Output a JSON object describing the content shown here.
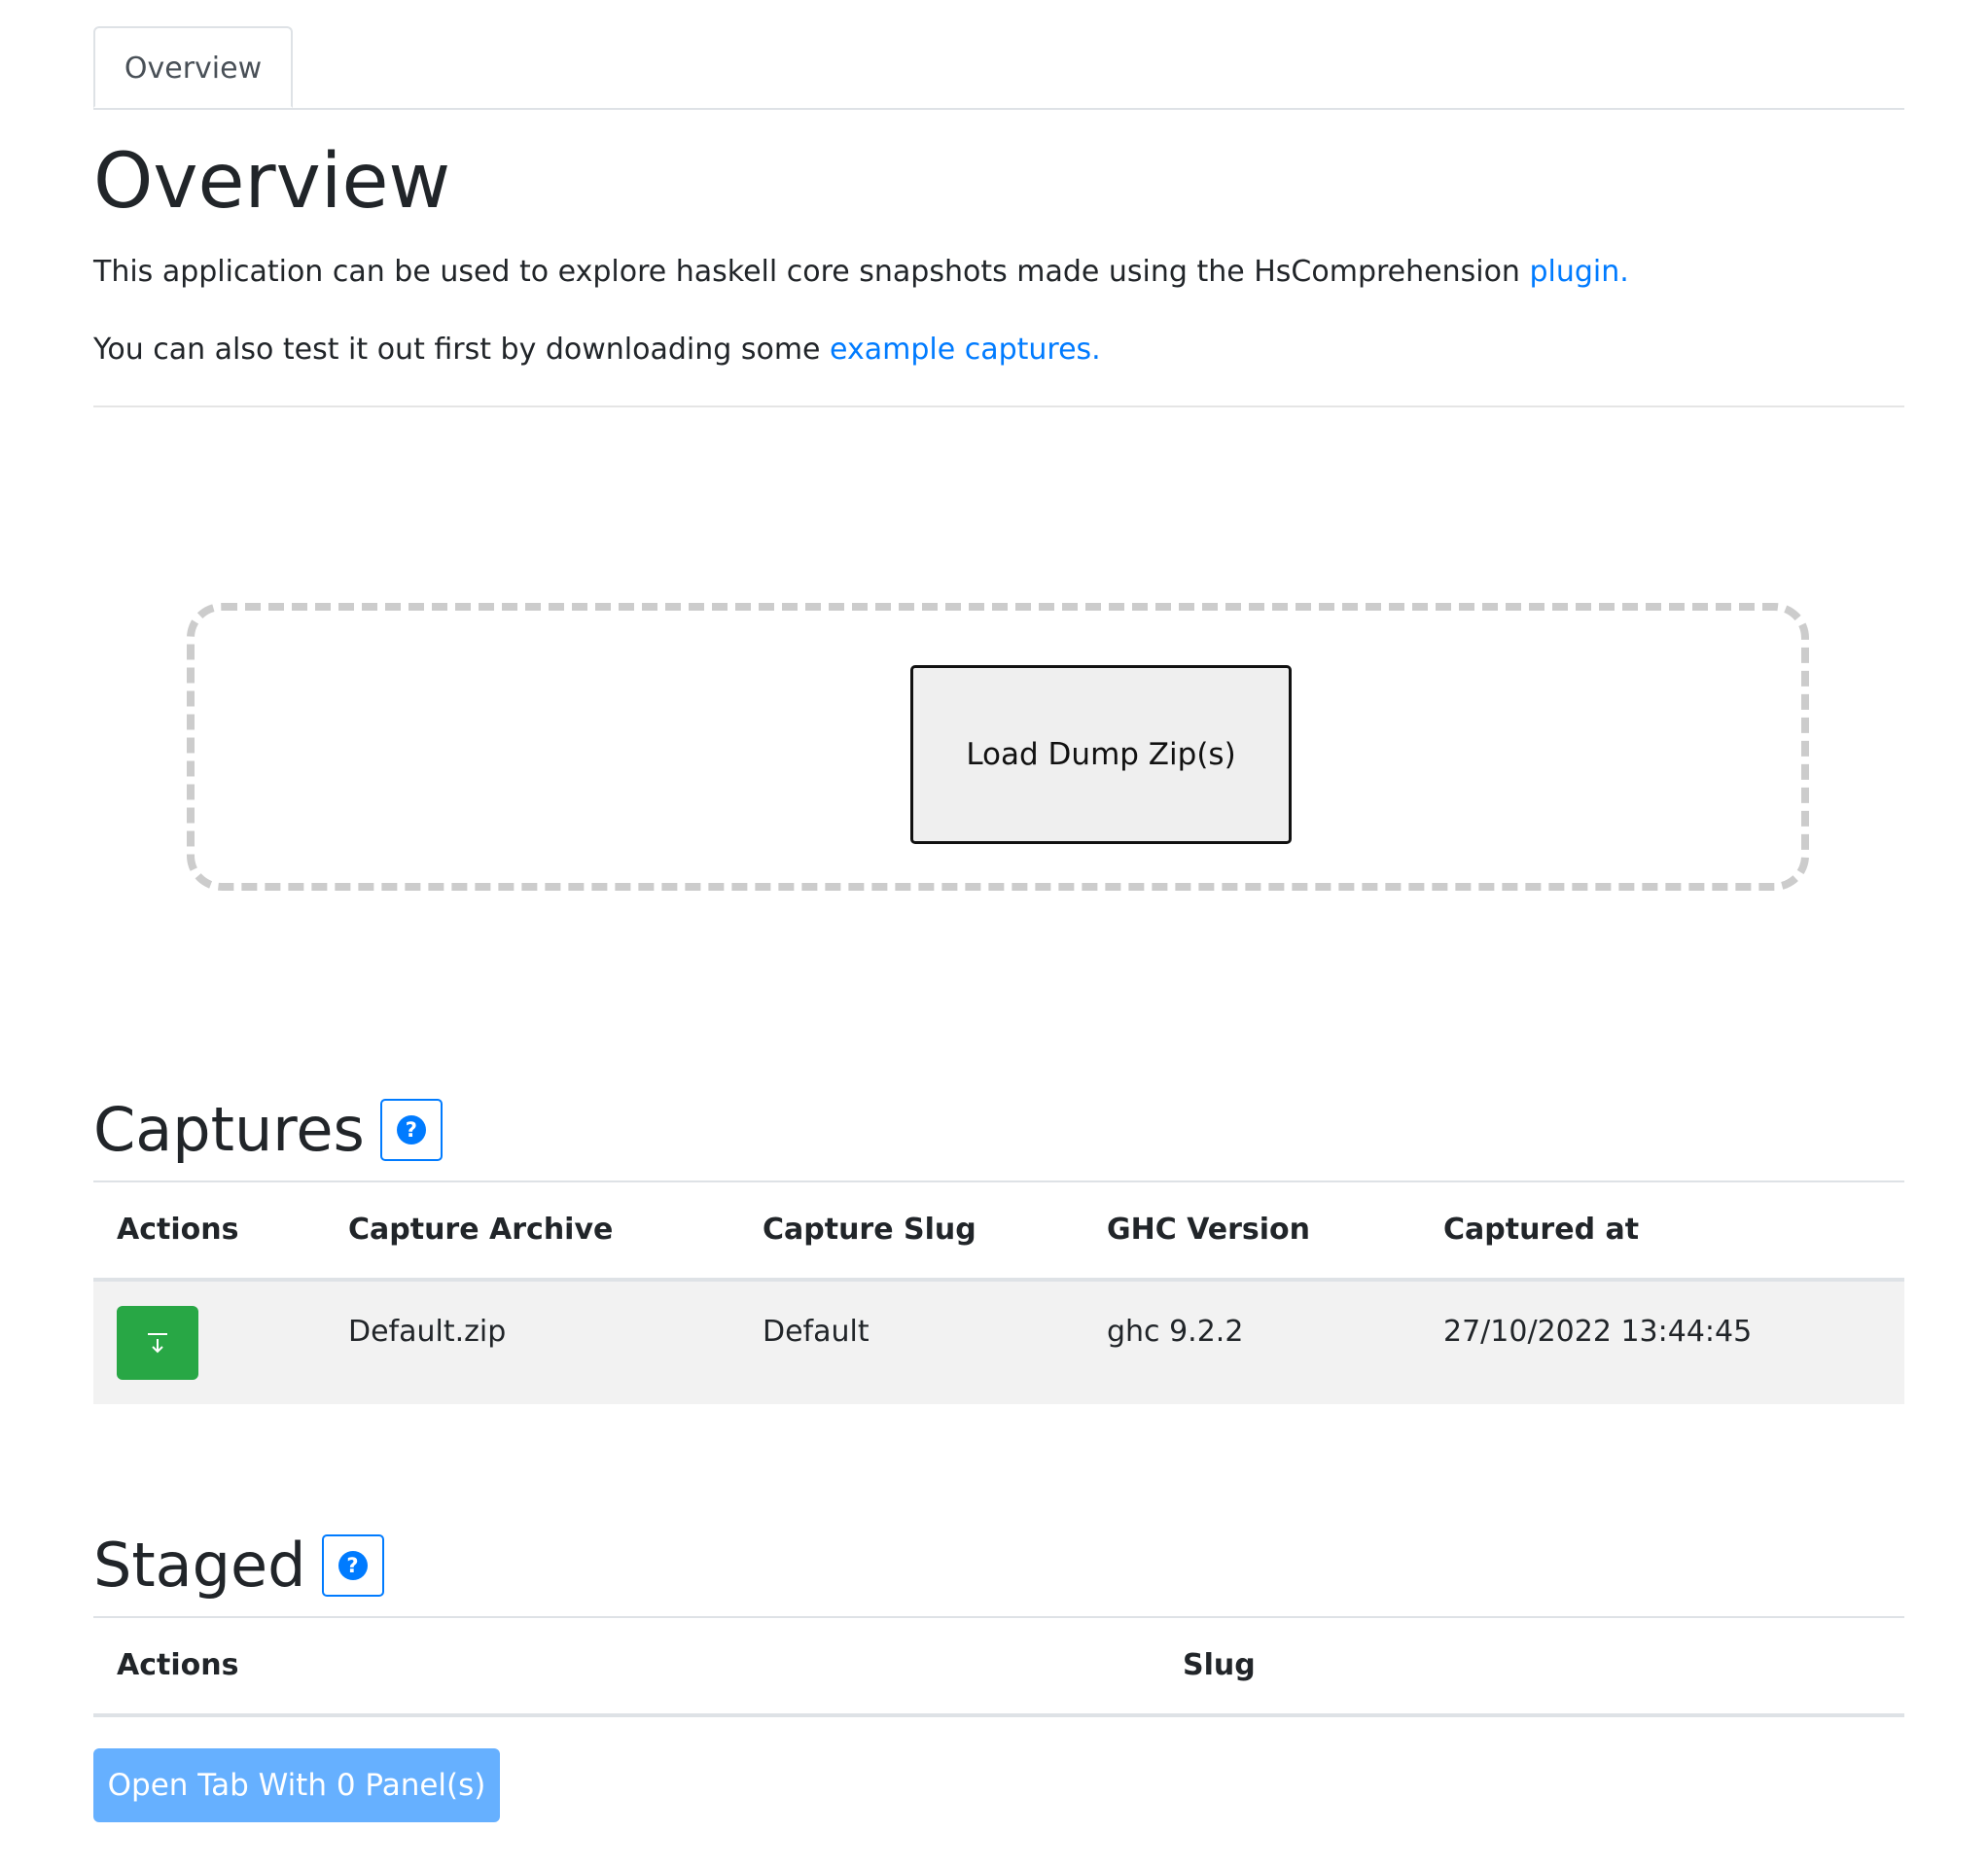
{
  "tabs": [
    {
      "label": "Overview"
    }
  ],
  "overview": {
    "title": "Overview",
    "intro_text": "This application can be used to explore haskell core snapshots made using the HsComprehension ",
    "intro_link": "plugin.",
    "test_text": "You can also test it out first by downloading some ",
    "test_link": "example captures."
  },
  "dropzone": {
    "button_label": "Load Dump Zip(s)"
  },
  "captures": {
    "title": "Captures",
    "help_symbol": "?",
    "columns": [
      "Actions",
      "Capture Archive",
      "Capture Slug",
      "GHC Version",
      "Captured at"
    ],
    "rows": [
      {
        "archive": "Default.zip",
        "slug": "Default",
        "ghc_version": "ghc 9.2.2",
        "captured_at": "27/10/2022 13:44:45",
        "action_icon": "download-icon"
      }
    ]
  },
  "staged": {
    "title": "Staged",
    "help_symbol": "?",
    "columns": [
      "Actions",
      "Slug"
    ],
    "open_button_label": "Open Tab With 0 Panel(s)"
  },
  "colors": {
    "link": "#007bff",
    "download_button": "#28a745",
    "open_button": "#66b0ff",
    "row_background": "#f2f2f2",
    "dropzone_border": "#cccccc"
  }
}
